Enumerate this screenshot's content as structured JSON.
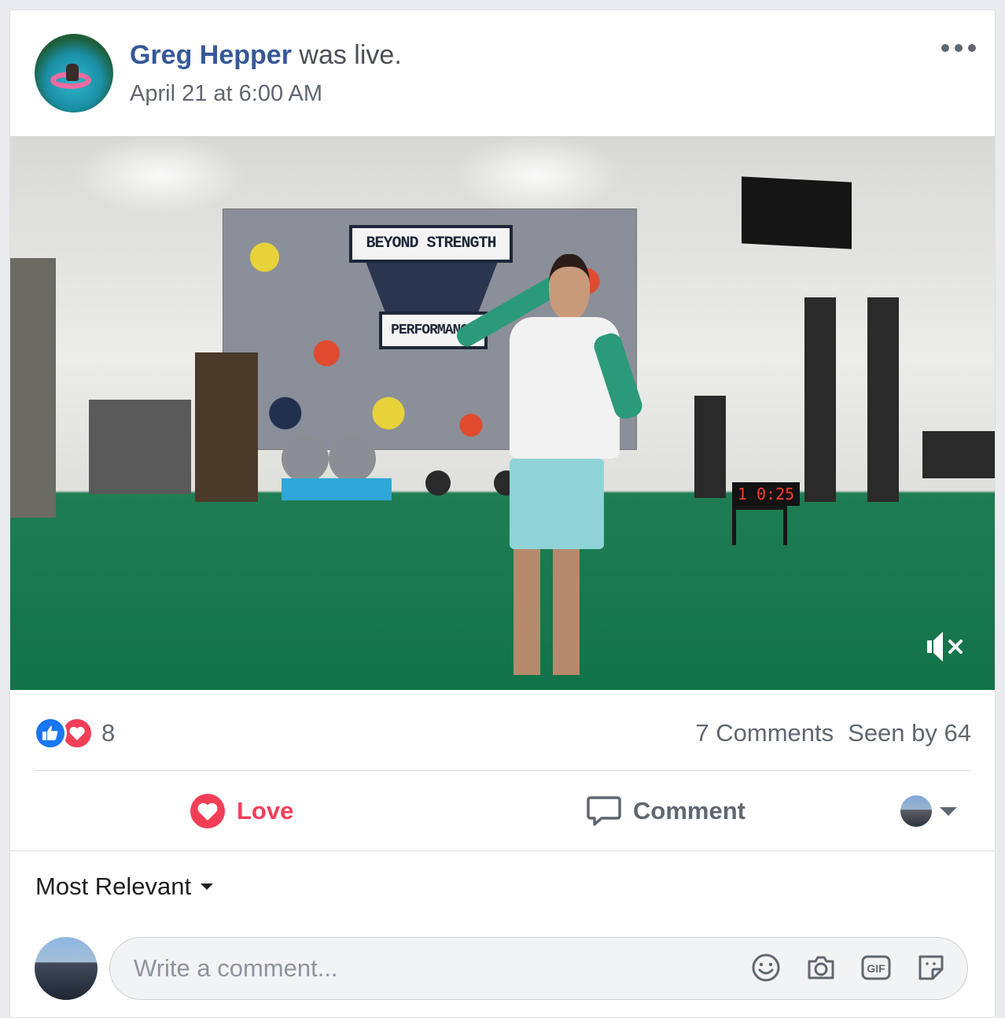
{
  "post": {
    "author": "Greg Hepper",
    "action_text": " was live.",
    "timestamp": "April 21 at 6:00 AM"
  },
  "video": {
    "mural_top": "BEYOND STRENGTH",
    "mural_bottom": "PERFORMANCE",
    "timer": "1  0:25",
    "muted": true
  },
  "stats": {
    "reaction_count": "8",
    "comments": "7 Comments",
    "seen_by": "Seen by 64"
  },
  "actions": {
    "love_label": "Love",
    "comment_label": "Comment"
  },
  "comments_section": {
    "sort_label": "Most Relevant",
    "placeholder": "Write a comment..."
  },
  "colors": {
    "author_link": "#365899",
    "love": "#f33e58",
    "like": "#1877f2"
  },
  "icons": [
    "more-icon",
    "mute-icon",
    "like-reaction-icon",
    "love-reaction-icon",
    "love-icon",
    "comment-icon",
    "caret-down-icon",
    "emoji-icon",
    "camera-icon",
    "gif-icon",
    "sticker-icon"
  ]
}
